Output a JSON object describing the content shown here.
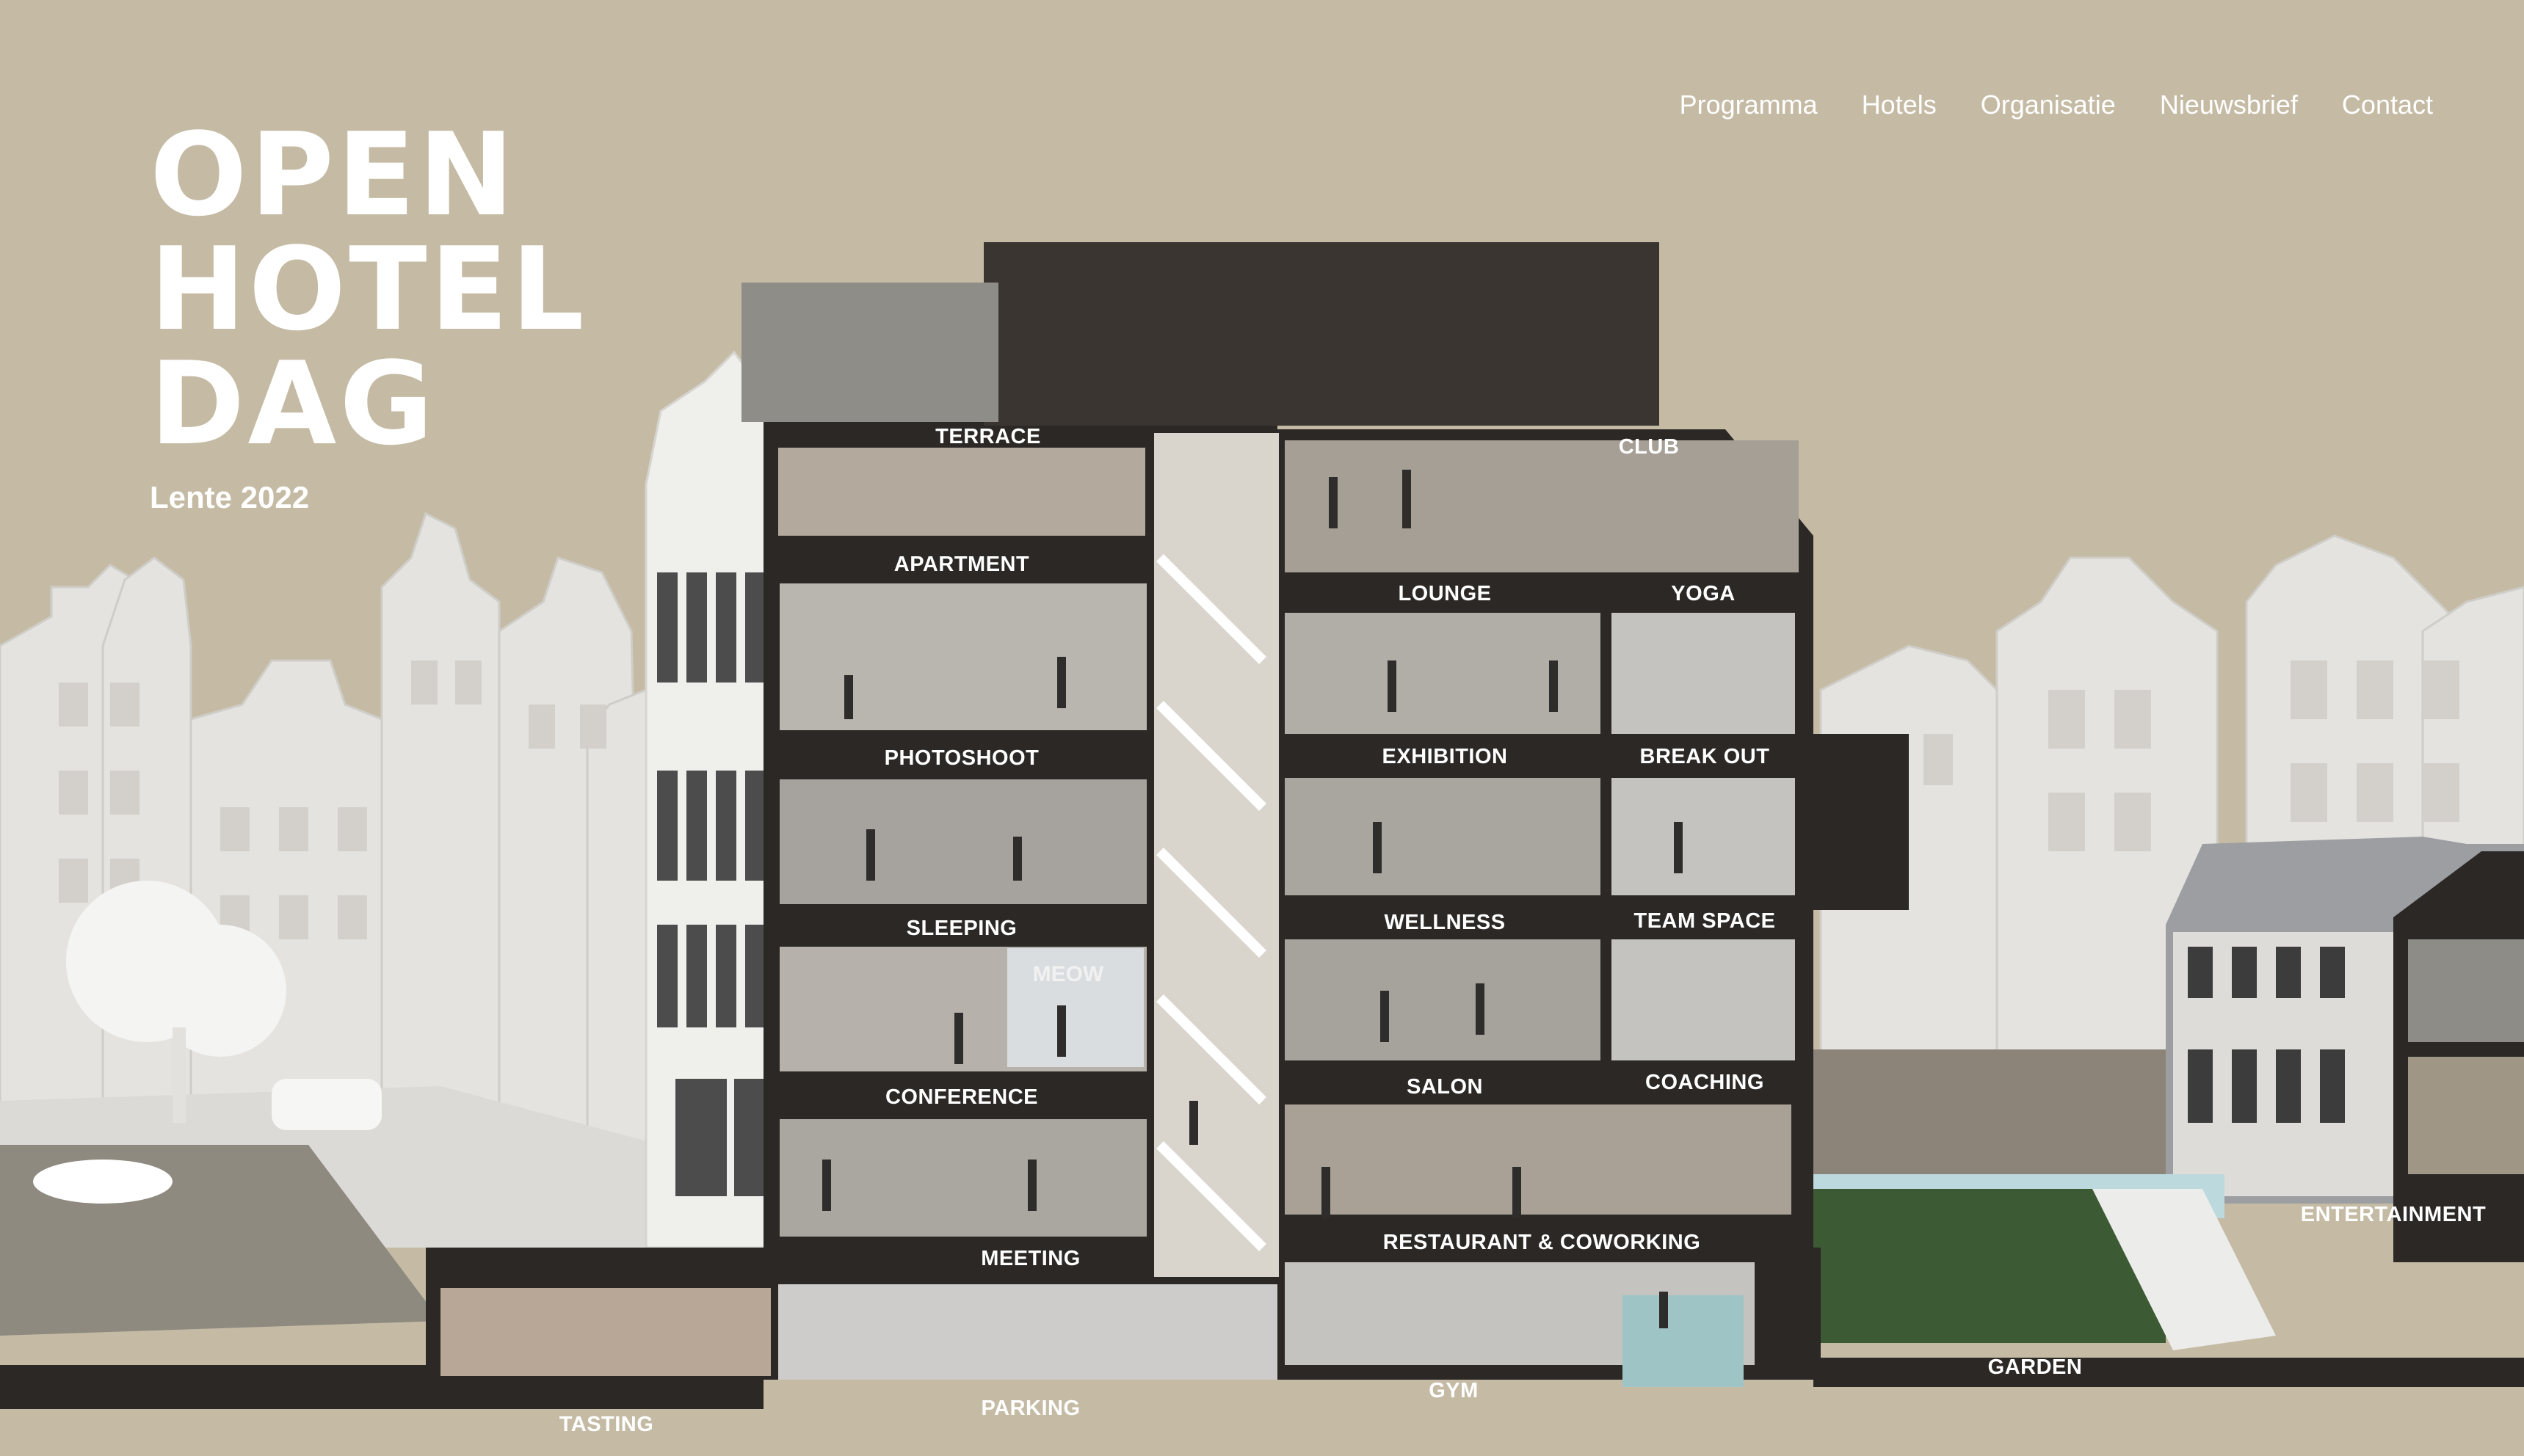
{
  "brand": {
    "lines": [
      "OPEN",
      "HOTEL",
      "DAG"
    ],
    "subtitle": "Lente 2022"
  },
  "nav": {
    "items": [
      "Programma",
      "Hotels",
      "Organisatie",
      "Nieuwsbrief",
      "Contact"
    ]
  },
  "rooms": {
    "terrace": "TERRACE",
    "club": "CLUB",
    "apartment": "APARTMENT",
    "lounge": "LOUNGE",
    "yoga": "YOGA",
    "photoshoot": "PHOTOSHOOT",
    "exhibition": "EXHIBITION",
    "break_out": "BREAK OUT",
    "sleeping": "SLEEPING",
    "wellness": "WELLNESS",
    "team_space": "TEAM SPACE",
    "conference": "CONFERENCE",
    "salon": "SALON",
    "coaching": "COACHING",
    "meeting": "MEETING",
    "restaurant_coworking": "RESTAURANT & COWORKING",
    "entertainment": "ENTERTAINMENT",
    "tasting": "TASTING",
    "parking": "PARKING",
    "gym": "GYM",
    "garden": "GARDEN"
  },
  "scene_text": {
    "screen": "MEOW"
  },
  "colors": {
    "background": "#c5bba5",
    "frame": "#2b2826",
    "label": "#ffffff",
    "city": "#e4e2de"
  }
}
